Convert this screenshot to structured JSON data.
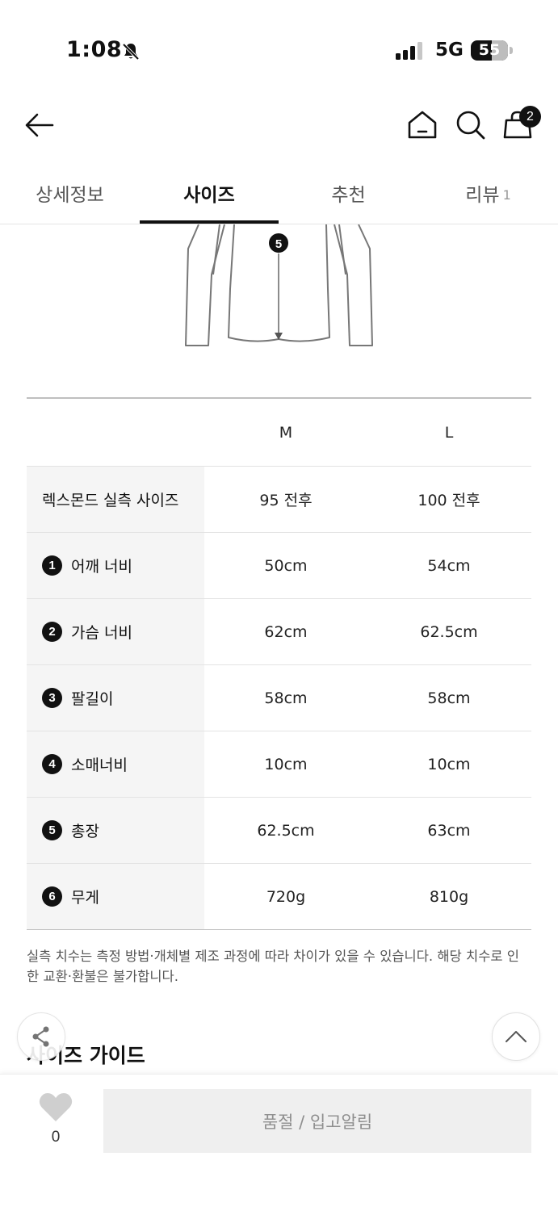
{
  "status_bar": {
    "time": "1:08",
    "network": "5G",
    "battery": "55"
  },
  "header": {
    "cart_count": "2"
  },
  "tabs": [
    {
      "label": "상세정보"
    },
    {
      "label": "사이즈"
    },
    {
      "label": "추천"
    },
    {
      "label": "리뷰",
      "count": "1"
    }
  ],
  "illustration": {
    "marker": "5"
  },
  "size_table": {
    "columns": [
      "M",
      "L"
    ],
    "rows": [
      {
        "label": "렉스몬드 실측 사이즈",
        "m": "95 전후",
        "l": "100 전후"
      },
      {
        "num": "1",
        "label": "어깨 너비",
        "m": "50cm",
        "l": "54cm"
      },
      {
        "num": "2",
        "label": "가슴 너비",
        "m": "62cm",
        "l": "62.5cm"
      },
      {
        "num": "3",
        "label": "팔길이",
        "m": "58cm",
        "l": "58cm"
      },
      {
        "num": "4",
        "label": "소매너비",
        "m": "10cm",
        "l": "10cm"
      },
      {
        "num": "5",
        "label": "총장",
        "m": "62.5cm",
        "l": "63cm"
      },
      {
        "num": "6",
        "label": "무게",
        "m": "720g",
        "l": "810g"
      }
    ]
  },
  "note": "실측 치수는 측정 방법·개체별 제조 과정에 따라 차이가 있을 수 있습니다. 해당 치수로 인한 교환·환불은 불가합니다.",
  "size_guide_title": "사이즈 가이드",
  "bottom_bar": {
    "like_count": "0",
    "soldout_label": "품절 / 입고알림"
  }
}
